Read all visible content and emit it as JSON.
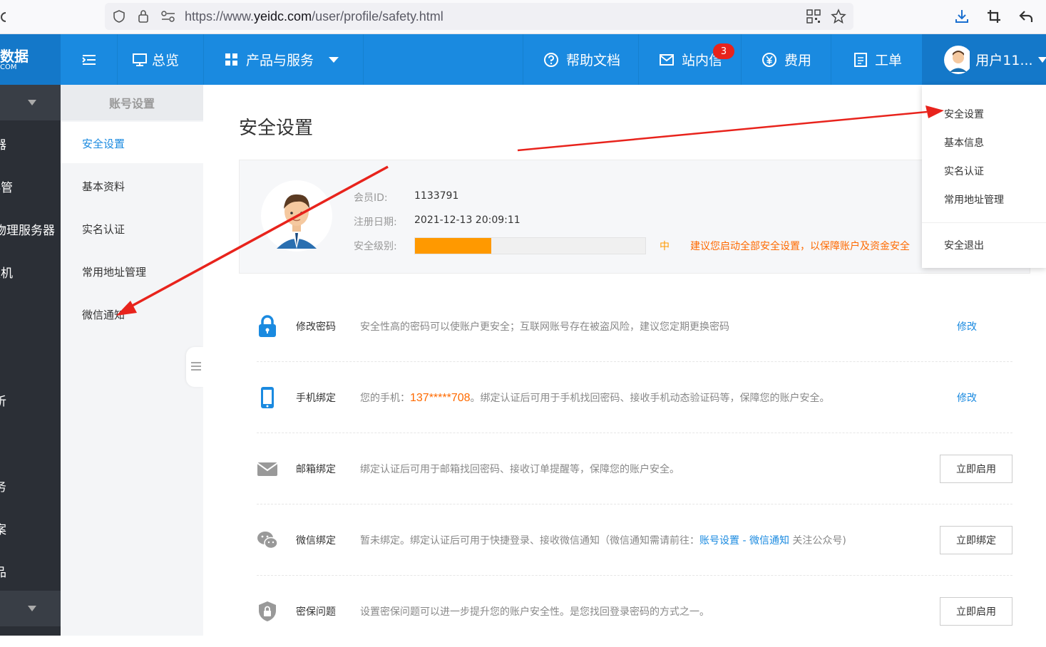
{
  "browser": {
    "url_prefix": "https://www.",
    "url_host": "yeidc.com",
    "url_path": "/user/profile/safety.html"
  },
  "brand": {
    "text": "数据",
    "sub": "COM"
  },
  "topnav": {
    "overview": "总览",
    "products": "产品与服务",
    "help": "帮助文档",
    "messages": "站内信",
    "messages_badge": "3",
    "billing": "费用",
    "tickets": "工单",
    "user": "用户11..."
  },
  "leftdark": {
    "items": [
      "器",
      "存管",
      "物理服务器",
      "主机",
      "析",
      "务",
      "案",
      "品"
    ]
  },
  "subnav": {
    "header": "账号设置",
    "items": [
      "安全设置",
      "基本资料",
      "实名认证",
      "常用地址管理",
      "微信通知"
    ]
  },
  "page": {
    "title": "安全设置",
    "member_id_label": "会员ID:",
    "member_id": "1133791",
    "reg_date_label": "注册日期:",
    "reg_date": "2021-12-13 20:09:11",
    "level_label": "安全级别:",
    "level_value": "中",
    "level_fraction": 0.33,
    "level_tip": "建议您启动全部安全设置，以保障账户及资金安全"
  },
  "rows": [
    {
      "title": "修改密码",
      "desc": "安全性高的密码可以使账户更安全；互联网账号存在被盗风险，建议您定期更换密码",
      "action": "修改",
      "icon": "lock-icon"
    },
    {
      "title": "手机绑定",
      "desc_pre": "您的手机：",
      "phone": "137*****708",
      "desc_post": "。绑定认证后可用于手机找回密码、接收手机动态验证码等，保障您的账户安全。",
      "action": "修改",
      "icon": "phone-icon"
    },
    {
      "title": "邮箱绑定",
      "desc": "绑定认证后可用于邮箱找回密码、接收订单提醒等，保障您的账户安全。",
      "action": "立即启用",
      "icon": "mail-icon"
    },
    {
      "title": "微信绑定",
      "desc_pre": "暂未绑定。绑定认证后可用于快捷登录、接收微信通知（微信通知需请前往：",
      "link": "账号设置 - 微信通知",
      "desc_post": " 关注公众号)",
      "action": "立即绑定",
      "icon": "wechat-icon"
    },
    {
      "title": "密保问题",
      "desc": "设置密保问题可以进一步提升您的账户安全性。是您找回登录密码的方式之一。",
      "action": "立即启用",
      "icon": "shield-icon"
    }
  ],
  "dropdown": {
    "items": [
      "安全设置",
      "基本信息",
      "实名认证",
      "常用地址管理"
    ],
    "logout": "安全退出"
  },
  "colors": {
    "primary": "#1a8ae0",
    "orange": "#ff9900",
    "dark": "#2b2f36",
    "arrow": "#e8231c"
  }
}
